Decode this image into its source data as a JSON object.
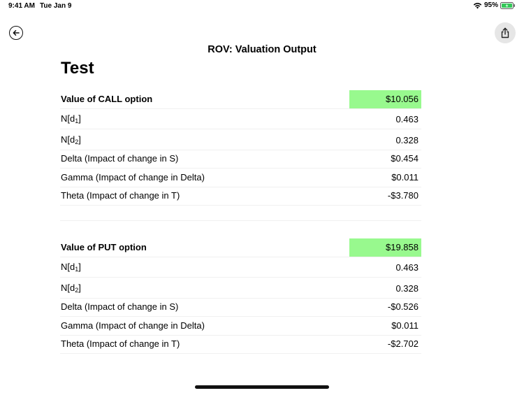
{
  "status_bar": {
    "time": "9:41 AM",
    "date": "Tue Jan 9",
    "battery": "95%"
  },
  "nav": {
    "title": "ROV: Valuation Output"
  },
  "page_title": "Test",
  "call": {
    "header_label": "Value of CALL option",
    "header_value": "$10.056",
    "rows": [
      {
        "label_main": "N[d",
        "label_sub": "1",
        "label_end": "]",
        "value": "0.463"
      },
      {
        "label_main": "N[d",
        "label_sub": "2",
        "label_end": "]",
        "value": "0.328"
      },
      {
        "label": "Delta (Impact of change in S)",
        "value": "$0.454"
      },
      {
        "label": "Gamma (Impact of change in Delta)",
        "value": "$0.011"
      },
      {
        "label": "Theta (Impact of change in T)",
        "value": "-$3.780"
      }
    ]
  },
  "put": {
    "header_label": "Value of PUT option",
    "header_value": "$19.858",
    "rows": [
      {
        "label_main": "N[d",
        "label_sub": "1",
        "label_end": "]",
        "value": "0.463"
      },
      {
        "label_main": "N[d",
        "label_sub": "2",
        "label_end": "]",
        "value": "0.328"
      },
      {
        "label": "Delta (Impact of change in S)",
        "value": "-$0.526"
      },
      {
        "label": "Gamma (Impact of change in Delta)",
        "value": "$0.011"
      },
      {
        "label": "Theta (Impact of change in T)",
        "value": "-$2.702"
      }
    ]
  },
  "colors": {
    "highlight": "#98f98e"
  },
  "icons": {
    "back": "arrow-left-circle-icon",
    "share": "share-icon"
  }
}
